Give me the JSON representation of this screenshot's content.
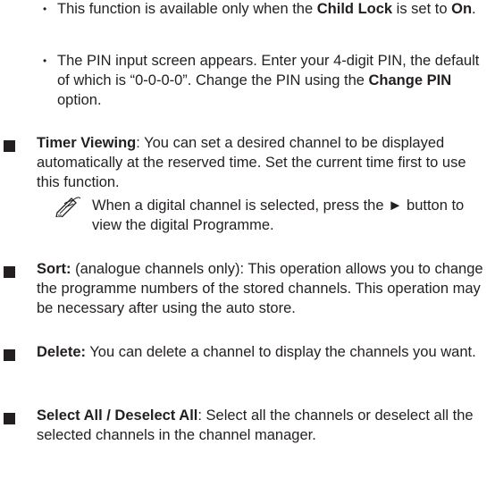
{
  "sub_bullets": [
    {
      "pre": "This function is available only when the ",
      "b1": "Child Lock",
      "mid": " is set to ",
      "b2": "On",
      "post": "."
    },
    {
      "pre": "The PIN input screen appears. Enter your 4-digit PIN, the default of which is “0-0-0-0”. Change the PIN using the ",
      "b1": "Change PIN",
      "post": " option."
    }
  ],
  "items": [
    {
      "term": "Timer Viewing",
      "text": ": You can set a desired channel to be displayed automatically at the reserved time. Set the current time first to use this function."
    },
    {
      "term": "Sort:",
      "text": " (analogue channels only): This operation allows you to change the programme numbers of the stored channels. This operation may be necessary after using the auto store."
    },
    {
      "term": "Delete:",
      "text": " You can delete a channel to display the channels you want."
    },
    {
      "term": "Select All / Deselect All",
      "text": ": Select all the channels or deselect all the selected channels in the channel manager."
    }
  ],
  "note": {
    "text": "When a digital channel is selected, press the ► button to view the digital Programme.",
    "icon": "pencil-note-icon"
  },
  "colors": {
    "text": "#231f20",
    "background": "#ffffff"
  }
}
